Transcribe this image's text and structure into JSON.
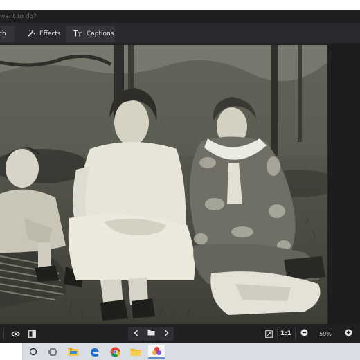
{
  "search": {
    "placeholder": "want to do?"
  },
  "tabs": [
    {
      "label": "ch",
      "icon": ""
    },
    {
      "label": "Effects",
      "icon": "magic-wand-icon"
    },
    {
      "label": "Captions",
      "icon": "text-caption-icon"
    }
  ],
  "bottom_toolbar": {
    "zoom_ratio": "1:1",
    "zoom_percent": "59%"
  },
  "taskbar": {
    "icons": [
      "cortana-icon",
      "task-view-icon",
      "file-explorer-icon",
      "edge-icon",
      "chrome-icon",
      "folder-icon",
      "photos-app-icon"
    ]
  },
  "colors": {
    "app_bg": "#242427",
    "toolbar_bg": "#2a2a2e",
    "taskbar_bg": "#d9dee4",
    "accent": "#5b8fd6"
  }
}
